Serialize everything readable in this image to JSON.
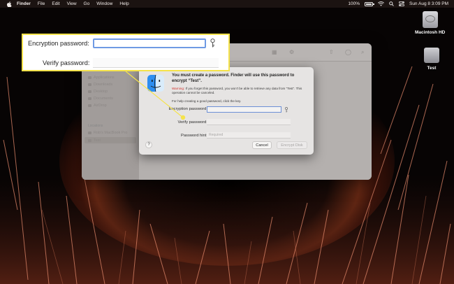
{
  "menubar": {
    "items": [
      "Finder",
      "File",
      "Edit",
      "View",
      "Go",
      "Window",
      "Help"
    ],
    "battery": "100%",
    "clock": "Sun Aug 8  3:09 PM"
  },
  "desktop": {
    "drive_label": "Macintosh HD",
    "volume_label": "Test"
  },
  "finder_sidebar": {
    "items": [
      "Applications",
      "Downloads",
      "Desktop",
      "Documents",
      "AirDrop"
    ],
    "locations_heading": "Locations",
    "locations": [
      "Rob's MacBook Pro",
      "Test"
    ]
  },
  "dialog": {
    "title": "You must create a password. Finder will use this password to encrypt “Test”.",
    "warning_prefix": "Warning:",
    "warning_text": " If you forget this password, you won't be able to retrieve any data from “Test”. This operation cannot be canceled.",
    "help_text": "For help creating a good password, click the key.",
    "encryption_label": "Encryption password:",
    "encryption_value": "",
    "verify_label": "Verify password:",
    "verify_value": "",
    "hint_label": "Password hint:",
    "hint_placeholder": "Required",
    "help_button": "?",
    "cancel_label": "Cancel",
    "encrypt_label": "Encrypt Disk"
  },
  "callout": {
    "encryption_label": "Encryption password:",
    "verify_label": "Verify password:"
  },
  "colors": {
    "callout_border": "#f5e34b",
    "focus_ring": "#6c8fd6",
    "warning_red": "#d0332d"
  },
  "icons": [
    "apple-icon",
    "wifi-icon",
    "battery-icon",
    "search-icon",
    "control-center-icon",
    "hard-drive-icon",
    "external-drive-icon",
    "finder-icon",
    "key-icon"
  ]
}
